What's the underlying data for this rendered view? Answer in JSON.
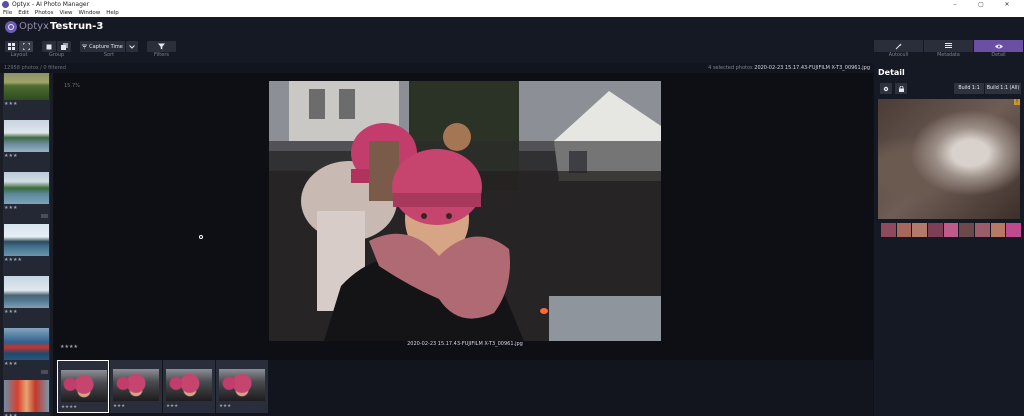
{
  "window": {
    "title": "Optyx - AI Photo Manager",
    "controls": [
      "–",
      "▢",
      "✕"
    ]
  },
  "menu": [
    "File",
    "Edit",
    "Photos",
    "View",
    "Window",
    "Help"
  ],
  "header": {
    "brand": "Optyx",
    "separator": "›",
    "project": "Testrun-3"
  },
  "toolbar": {
    "layout_label": "Layout",
    "group_label": "Group",
    "sort_label": "Sort",
    "sort_value": "Capture Time",
    "filters_label": "Filters"
  },
  "status": {
    "count": "12958 photos / 0 filtered",
    "selected_prefix": "4 selected photos",
    "selected_file": "2020-02-23 15.17.43-FUJIFILM X-T3_00961.jpg"
  },
  "viewer": {
    "zoom": "15.7%",
    "filename": "2020-02-23 15.17.43-FUJIFILM X-T3_00961.jpg",
    "stars": "★★★★"
  },
  "left_strip": {
    "items": [
      {
        "stars": "★★★",
        "scene": "field"
      },
      {
        "stars": "★★★",
        "scene": "lake"
      },
      {
        "stars": "★★★",
        "scene": "boat"
      },
      {
        "stars": "★★★★",
        "scene": "water"
      },
      {
        "stars": "★★★",
        "scene": "hills"
      },
      {
        "stars": "★★★",
        "scene": "kayak"
      },
      {
        "stars": "★★★",
        "scene": "kids"
      }
    ]
  },
  "filmstrip": {
    "items": [
      {
        "stars": "★★★★"
      },
      {
        "stars": "★★★"
      },
      {
        "stars": "★★★"
      },
      {
        "stars": "★★★"
      }
    ]
  },
  "right_panel": {
    "tabs": [
      {
        "label": "Autocull",
        "icon": "wand-icon"
      },
      {
        "label": "Metadata",
        "icon": "list-icon"
      },
      {
        "label": "Detail",
        "icon": "eye-icon"
      }
    ],
    "title": "Detail",
    "build1": "Build 1:1",
    "build_all": "Build 1:1 (All)",
    "warning": "!"
  },
  "colors": {
    "accent": "#6b4fa5",
    "bg": "#0f1118",
    "panel": "#151923"
  }
}
